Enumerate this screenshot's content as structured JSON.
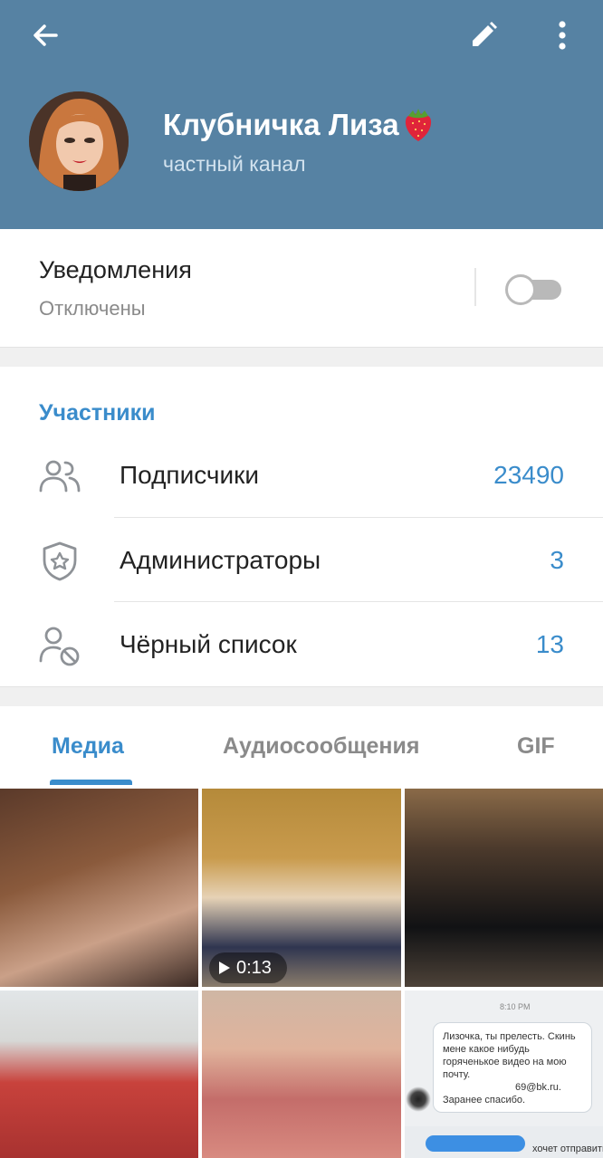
{
  "header": {
    "title": "Клубничка Лиза",
    "title_emoji": "strawberry-emoji",
    "subtitle": "частный канал",
    "back_icon": "arrow-left-icon",
    "edit_icon": "pencil-icon",
    "more_icon": "more-vertical-icon",
    "color": "#5682a3"
  },
  "notifications": {
    "label": "Уведомления",
    "value": "Отключены",
    "enabled": false
  },
  "members": {
    "title": "Участники",
    "rows": [
      {
        "icon": "users-icon",
        "label": "Подписчики",
        "value": "23490"
      },
      {
        "icon": "shield-star-icon",
        "label": "Администраторы",
        "value": "3"
      },
      {
        "icon": "user-blocked-icon",
        "label": "Чёрный список",
        "value": "13"
      }
    ]
  },
  "tabs": [
    {
      "label": "Медиа",
      "active": true
    },
    {
      "label": "Аудиосообщения",
      "active": false
    },
    {
      "label": "GIF",
      "active": false
    }
  ],
  "media": {
    "video_duration": "0:13",
    "chat_preview": {
      "time": "8:10 PM",
      "line1": "Лизочка, ты прелесть. Скинь",
      "line2": "мене какое нибудь",
      "line3": "горяченькое видео на мою",
      "line4": "почту.",
      "line5": "69@bk.ru.",
      "line6": "Заранее спасибо.",
      "footer": "хочет отправить"
    }
  },
  "colors": {
    "accent": "#3a8ccb",
    "secondary_text": "#8a8a8a",
    "section_gap": "#f0f0f0"
  }
}
